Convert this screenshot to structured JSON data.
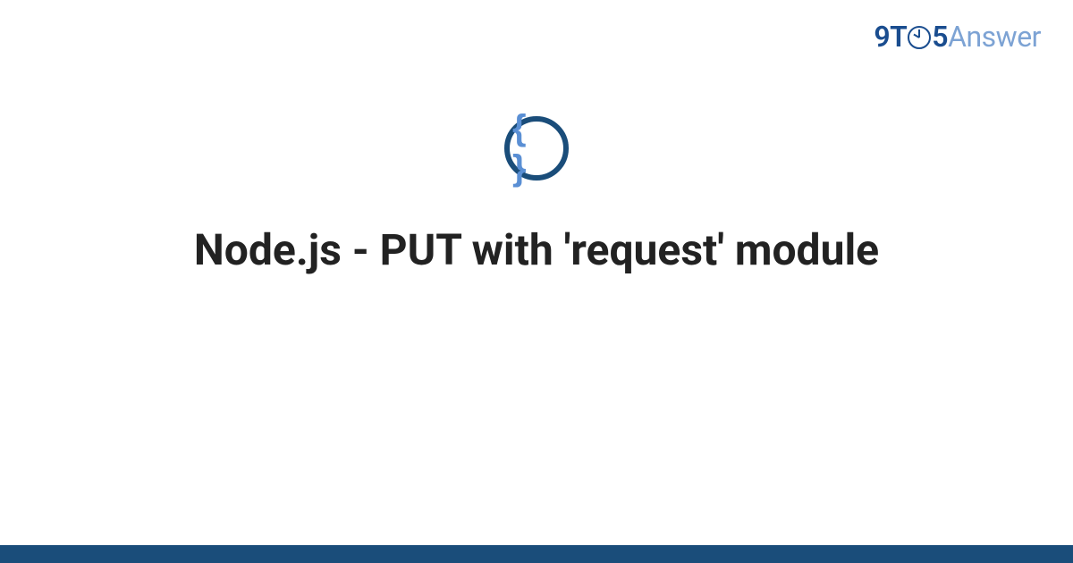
{
  "logo": {
    "nine": "9",
    "t": "T",
    "five": "5",
    "answer": "Answer"
  },
  "icon": {
    "name": "code-braces-icon",
    "glyph": "{ }"
  },
  "title": "Node.js - PUT with 'request' module",
  "colors": {
    "brand_dark": "#1a4d7a",
    "brand_light": "#7da3d4",
    "brace_blue": "#5a8fd4",
    "text": "#222222"
  }
}
